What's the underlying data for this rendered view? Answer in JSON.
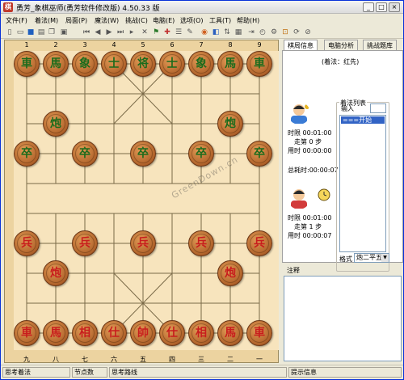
{
  "window": {
    "title": "勇芳_象棋巫师(勇芳软件修改版) 4.50.33 版"
  },
  "menu": [
    "文件(F)",
    "着法(M)",
    "局面(P)",
    "魔法(W)",
    "挑战(C)",
    "电脑(E)",
    "选项(O)",
    "工具(T)",
    "帮助(H)"
  ],
  "top_columns": [
    "1",
    "2",
    "3",
    "4",
    "5",
    "6",
    "7",
    "8",
    "9"
  ],
  "bottom_columns": [
    "九",
    "八",
    "七",
    "六",
    "五",
    "四",
    "三",
    "二",
    "一"
  ],
  "pieces": [
    {
      "side": "black",
      "label": "車",
      "col": 0,
      "row": 0
    },
    {
      "side": "black",
      "label": "馬",
      "col": 1,
      "row": 0
    },
    {
      "side": "black",
      "label": "象",
      "col": 2,
      "row": 0
    },
    {
      "side": "black",
      "label": "士",
      "col": 3,
      "row": 0
    },
    {
      "side": "black",
      "label": "将",
      "col": 4,
      "row": 0
    },
    {
      "side": "black",
      "label": "士",
      "col": 5,
      "row": 0
    },
    {
      "side": "black",
      "label": "象",
      "col": 6,
      "row": 0
    },
    {
      "side": "black",
      "label": "馬",
      "col": 7,
      "row": 0
    },
    {
      "side": "black",
      "label": "車",
      "col": 8,
      "row": 0
    },
    {
      "side": "black",
      "label": "炮",
      "col": 1,
      "row": 2
    },
    {
      "side": "black",
      "label": "炮",
      "col": 7,
      "row": 2
    },
    {
      "side": "black",
      "label": "卒",
      "col": 0,
      "row": 3
    },
    {
      "side": "black",
      "label": "卒",
      "col": 2,
      "row": 3
    },
    {
      "side": "black",
      "label": "卒",
      "col": 4,
      "row": 3
    },
    {
      "side": "black",
      "label": "卒",
      "col": 6,
      "row": 3
    },
    {
      "side": "black",
      "label": "卒",
      "col": 8,
      "row": 3
    },
    {
      "side": "red",
      "label": "兵",
      "col": 0,
      "row": 6
    },
    {
      "side": "red",
      "label": "兵",
      "col": 2,
      "row": 6
    },
    {
      "side": "red",
      "label": "兵",
      "col": 4,
      "row": 6
    },
    {
      "side": "red",
      "label": "兵",
      "col": 6,
      "row": 6
    },
    {
      "side": "red",
      "label": "兵",
      "col": 8,
      "row": 6
    },
    {
      "side": "red",
      "label": "炮",
      "col": 1,
      "row": 7
    },
    {
      "side": "red",
      "label": "炮",
      "col": 7,
      "row": 7
    },
    {
      "side": "red",
      "label": "車",
      "col": 0,
      "row": 9
    },
    {
      "side": "red",
      "label": "馬",
      "col": 1,
      "row": 9
    },
    {
      "side": "red",
      "label": "相",
      "col": 2,
      "row": 9
    },
    {
      "side": "red",
      "label": "仕",
      "col": 3,
      "row": 9
    },
    {
      "side": "red",
      "label": "帥",
      "col": 4,
      "row": 9
    },
    {
      "side": "red",
      "label": "仕",
      "col": 5,
      "row": 9
    },
    {
      "side": "red",
      "label": "相",
      "col": 6,
      "row": 9
    },
    {
      "side": "red",
      "label": "馬",
      "col": 7,
      "row": 9
    },
    {
      "side": "red",
      "label": "車",
      "col": 8,
      "row": 9
    }
  ],
  "watermark": "GreenDown.cn",
  "tabs": [
    "棋局信息",
    "电脑分析",
    "挑战题库"
  ],
  "info": {
    "turn": "(着法：红先)",
    "black_time_limit": "时限  00:01:00",
    "black_moves": "走第 0 步",
    "black_used": "用时  00:00:00",
    "total_time": "总耗时:00:00:07",
    "red_time_limit": "时限  00:01:00",
    "red_moves": "走第 1 步",
    "red_used": "用时  00:00:07"
  },
  "movelist": {
    "title": "着法列表",
    "input_label": "输入",
    "first_move": "===开始===",
    "format_label": "格式",
    "format_value": "炮二平五"
  },
  "notes_label": "注释",
  "status": [
    "思考着法",
    "节点数",
    "思考路线",
    "提示信息"
  ],
  "colors": {
    "board": "#f7e4bd",
    "red_piece_text": "#c81d1d",
    "black_piece_text": "#1c6b1c",
    "selection": "#3163c5"
  }
}
